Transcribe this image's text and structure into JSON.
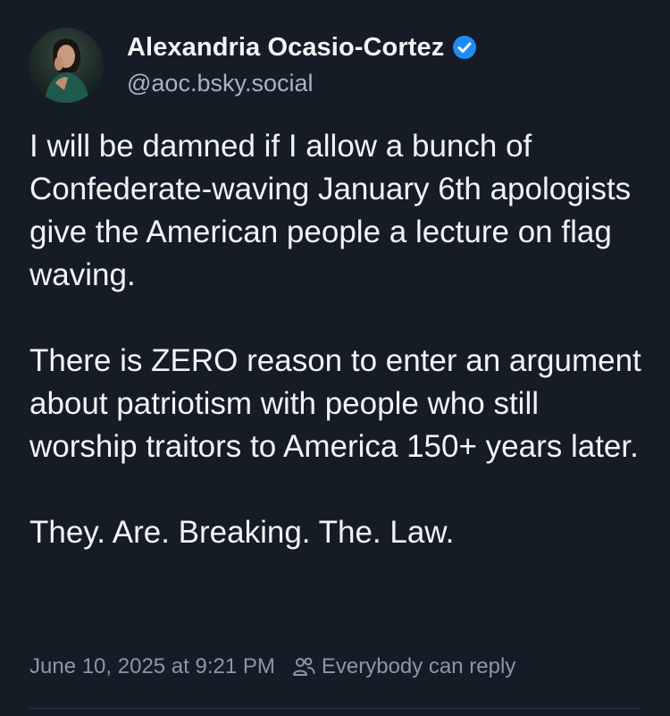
{
  "author": {
    "display_name": "Alexandria Ocasio-Cortez",
    "handle": "@aoc.bsky.social",
    "verified": true,
    "verified_color": "#1d8cf5"
  },
  "post": {
    "paragraphs": [
      "I will be damned if I allow a bunch of Confederate-waving January 6th apologists give the American people a lecture on flag waving.",
      "There is ZERO reason to enter an argument about patriotism with people who still worship traitors to America 150+ years later.",
      "They. Are. Breaking. The. Law."
    ]
  },
  "footer": {
    "timestamp": "June 10, 2025 at 9:21 PM",
    "reply_setting": "Everybody can reply",
    "reply_icon": "people-icon"
  },
  "theme": {
    "background": "#151c26",
    "text": "#f1f3f5",
    "muted": "#8b97a6"
  }
}
